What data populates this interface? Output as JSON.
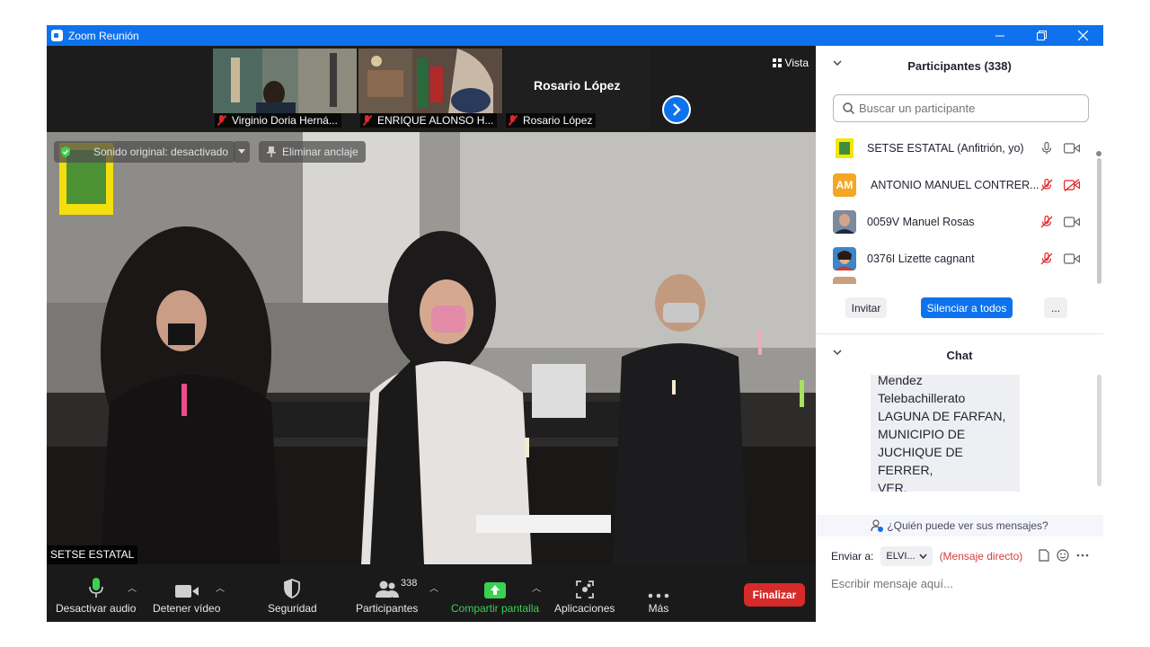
{
  "window": {
    "title": "Zoom Reunión",
    "controls": [
      "minimize-icon",
      "restore-icon",
      "close-icon"
    ]
  },
  "strip": {
    "thumbnails": [
      {
        "name": "Virginio Doria Herná..."
      },
      {
        "name": "ENRIQUE ALONSO H..."
      },
      {
        "name": "Rosario López"
      }
    ],
    "active_speaker": "Rosario López",
    "view_label": "Vista"
  },
  "main_video": {
    "sound_label": "Sonido original: desactivado",
    "unpin_label": "Eliminar anclaje",
    "name_tag": "SETSE ESTATAL"
  },
  "toolbar": {
    "audio": "Desactivar audio",
    "video": "Detener vídeo",
    "security": "Seguridad",
    "participants": "Participantes",
    "participants_count": "338",
    "share": "Compartir pantalla",
    "apps": "Aplicaciones",
    "more": "Más",
    "end": "Finalizar",
    "colors": {
      "share": "#3ad153",
      "end": "#d72a2a",
      "accent": "#0e72ed"
    }
  },
  "participants_panel": {
    "title": "Participantes (338)",
    "search_placeholder": "Buscar un participante",
    "items": [
      {
        "name": "SETSE ESTATAL (Anfitrión, yo)",
        "mic": "mic-on-icon",
        "cam": "camera-icon"
      },
      {
        "name": "ANTONIO MANUEL CONTRER...",
        "initials": "AM",
        "mic": "mic-muted-icon",
        "cam": "camera-off-icon"
      },
      {
        "name": "0059V Manuel Rosas",
        "mic": "mic-muted-icon",
        "cam": "camera-icon"
      },
      {
        "name": "0376I Lizette cagnant",
        "mic": "mic-muted-icon",
        "cam": "camera-icon"
      }
    ],
    "buttons": {
      "invite": "Invitar",
      "mute_all": "Silenciar a todos",
      "more": "..."
    }
  },
  "chat": {
    "title": "Chat",
    "message_lines": [
      "Mendez",
      "Telebachillerato",
      "LAGUNA DE FARFAN,",
      "MUNICIPIO DE",
      "JUCHIQUE DE FERRER,",
      "VER."
    ],
    "who_can_see": "¿Quién puede ver sus mensajes?",
    "send_to_label": "Enviar a:",
    "send_to_value": "ELVI...",
    "direct_label": "(Mensaje directo)",
    "input_placeholder": "Escribir mensaje aquí..."
  }
}
